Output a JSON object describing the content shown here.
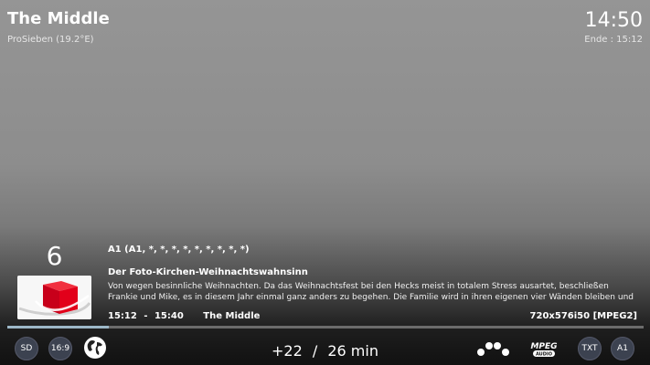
{
  "program": {
    "title": "The Middle",
    "channel_source": "ProSieben (19.2°E)"
  },
  "clock": {
    "time": "14:50",
    "end_label": "Ende : 15:12"
  },
  "channel": {
    "number": "6",
    "logo_icon": "prosieben-logo-icon"
  },
  "info": {
    "audio_tracks": "A1 (A1, *, *, *, *, *, *, *, *, *)",
    "episode_title": "Der Foto-Kirchen-Weihnachtswahnsinn",
    "description": "Von wegen besinnliche Weihnachten. Da das Weihnachtsfest bei den Hecks meist in totalem Stress ausartet, beschließen Frankie und Mike, es in diesem Jahr einmal ganz anders zu begehen. Die Familie wird in ihren eigenen vier Wänden bleiben und die",
    "start_time": "15:12",
    "separator": "-",
    "end_time": "15:40",
    "now_title": "The Middle",
    "video_format": "720x576i50 [MPEG2]"
  },
  "progress": {
    "fraction": 0.16
  },
  "bottom_bar": {
    "sd_label": "SD",
    "aspect_label": "16:9",
    "globe_icon": "globe-icon",
    "remaining_offset": "+22",
    "remaining_separator": "/",
    "remaining_total": "26 min",
    "signal_icon": "signal-dots-icon",
    "mpeg_top": "MPEG",
    "mpeg_bottom": "AUDIO",
    "txt_label": "TXT",
    "audio_label": "A1"
  },
  "colors": {
    "button_bg": "#3c4250",
    "progress_fill": "#9db8c8",
    "logo_red": "#e2001a"
  }
}
